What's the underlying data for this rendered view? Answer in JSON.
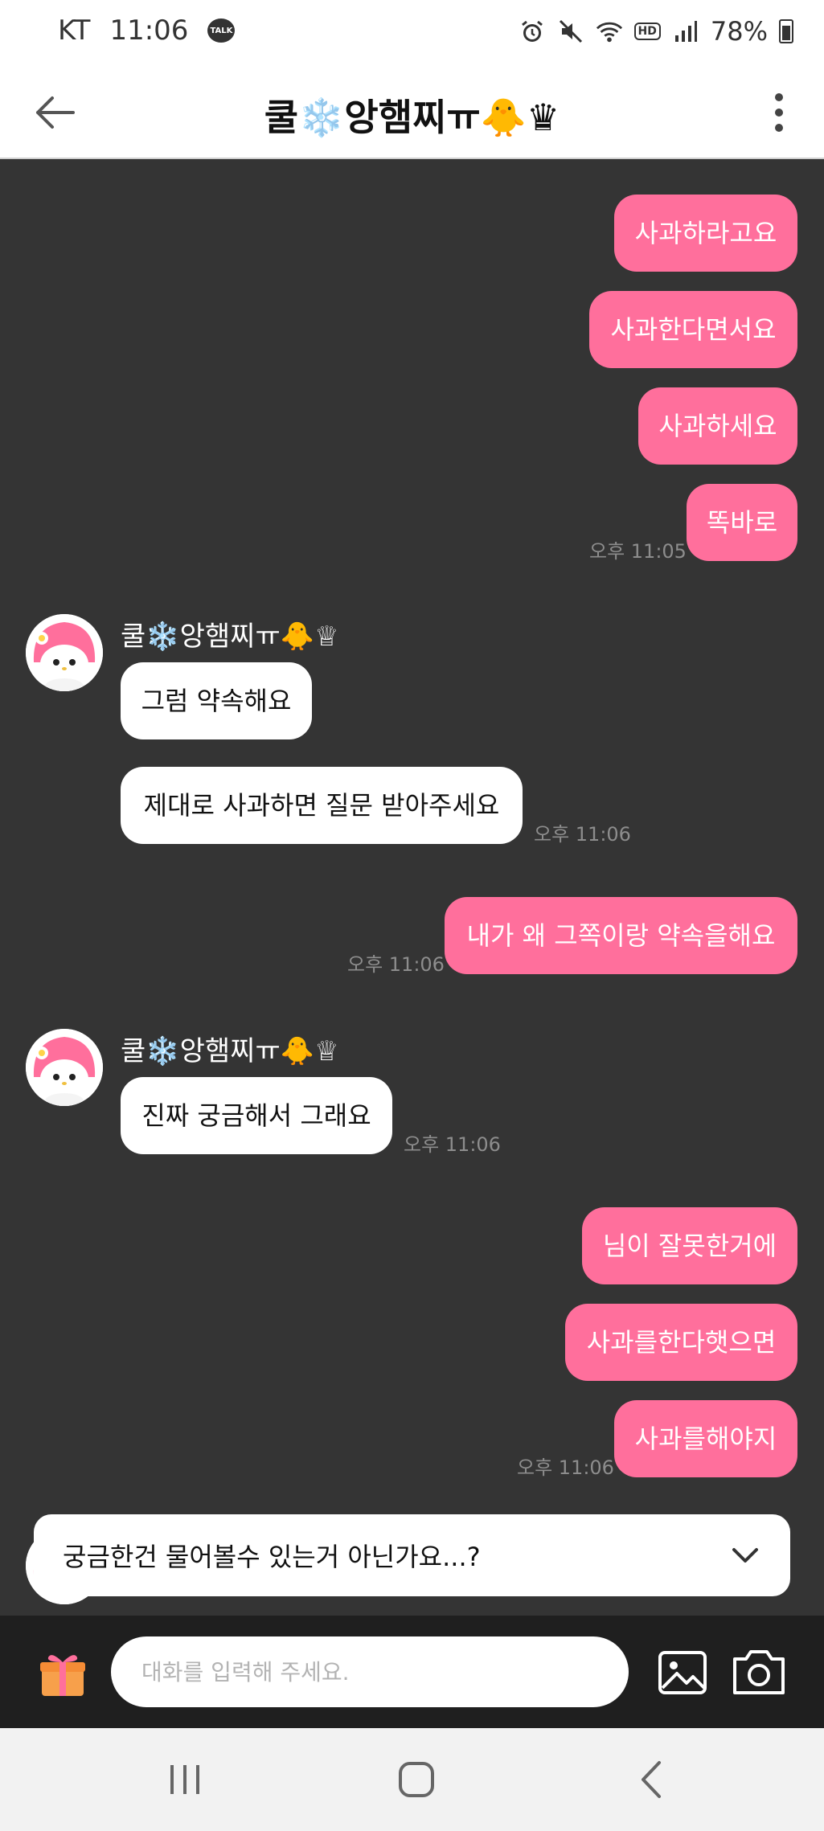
{
  "status_bar": {
    "carrier": "KT",
    "time": "11:06",
    "talk_badge": "TALK",
    "hd_label": "HD",
    "battery": "78%"
  },
  "header": {
    "title": "쿨❄️앙햄찌ㅠ🐥♛"
  },
  "messages": [
    {
      "from": "me",
      "text": "사과하라고요"
    },
    {
      "from": "me",
      "text": "사과한다면서요"
    },
    {
      "from": "me",
      "text": "사과하세요"
    },
    {
      "from": "me",
      "text": "똑바로",
      "time": "오후 11:05"
    },
    {
      "from": "them",
      "sender": "쿨❄️앙햄찌ㅠ🐥♕",
      "text": "그럼 약속해요"
    },
    {
      "from": "them",
      "text": "제대로 사과하면 질문 받아주세요",
      "time": "오후 11:06"
    },
    {
      "from": "me",
      "text": "내가 왜 그쪽이랑 약속을해요",
      "time": "오후 11:06"
    },
    {
      "from": "them",
      "sender": "쿨❄️앙햄찌ㅠ🐥♕",
      "text": "진짜 궁금해서 그래요",
      "time": "오후 11:06"
    },
    {
      "from": "me",
      "text": "님이 잘못한거에"
    },
    {
      "from": "me",
      "text": "사과를한다햇으면"
    },
    {
      "from": "me",
      "text": "사과를해야지",
      "time": "오후 11:06"
    }
  ],
  "notice": {
    "text": "궁금한건 물어볼수 있는거 아닌가요...?"
  },
  "input": {
    "placeholder": "대화를 입력해 주세요."
  },
  "colors": {
    "my_bubble": "#ff6f9c",
    "their_bubble": "#ffffff",
    "chat_background": "#343434",
    "input_bar": "#1f1f1f"
  },
  "icons": {
    "back": "arrow-left-icon",
    "more": "kebab-menu-icon",
    "gift": "gift-icon",
    "image": "image-icon",
    "camera": "camera-icon",
    "expand": "chevron-down-icon"
  }
}
